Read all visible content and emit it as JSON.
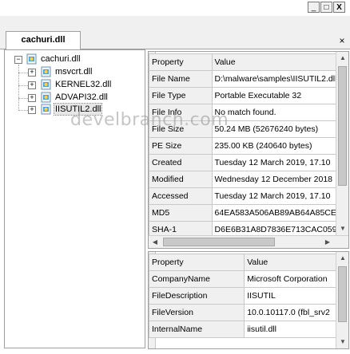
{
  "window": {
    "minimize": "_",
    "maximize": "□",
    "close": "X"
  },
  "tab": {
    "label": "cachuri.dll",
    "close": "×"
  },
  "tree": {
    "root": "cachuri.dll",
    "children": [
      "msvcrt.dll",
      "KERNEL32.dll",
      "ADVAPI32.dll",
      "IISUTIL2.dll"
    ],
    "expander": "+",
    "collapser": "−"
  },
  "file_props": {
    "headers": [
      "Property",
      "Value"
    ],
    "rows": [
      [
        "File Name",
        "D:\\malware\\samples\\IISUTIL2.dll"
      ],
      [
        "File Type",
        "Portable Executable 32"
      ],
      [
        "File Info",
        "No match found."
      ],
      [
        "File Size",
        "50.24 MB (52676240 bytes)"
      ],
      [
        "PE Size",
        "235.00 KB (240640 bytes)"
      ],
      [
        "Created",
        "Tuesday 12 March 2019, 17.10"
      ],
      [
        "Modified",
        "Wednesday 12 December 2018"
      ],
      [
        "Accessed",
        "Tuesday 12 March 2019, 17.10"
      ],
      [
        "MD5",
        "64EA583A506AB89AB64A85CE"
      ],
      [
        "SHA-1",
        "D6E6B31A8D7836E713CAC059"
      ]
    ]
  },
  "version_props": {
    "headers": [
      "Property",
      "Value"
    ],
    "rows": [
      [
        "CompanyName",
        "Microsoft Corporation"
      ],
      [
        "FileDescription",
        "IISUTIL"
      ],
      [
        "FileVersion",
        "10.0.10117.0 (fbl_srv2"
      ],
      [
        "InternalName",
        "iisutil.dll"
      ]
    ]
  },
  "watermark": "develbranch.com",
  "scroll": {
    "left": "◀",
    "right": "▶",
    "up": "▲",
    "down": "▼"
  }
}
